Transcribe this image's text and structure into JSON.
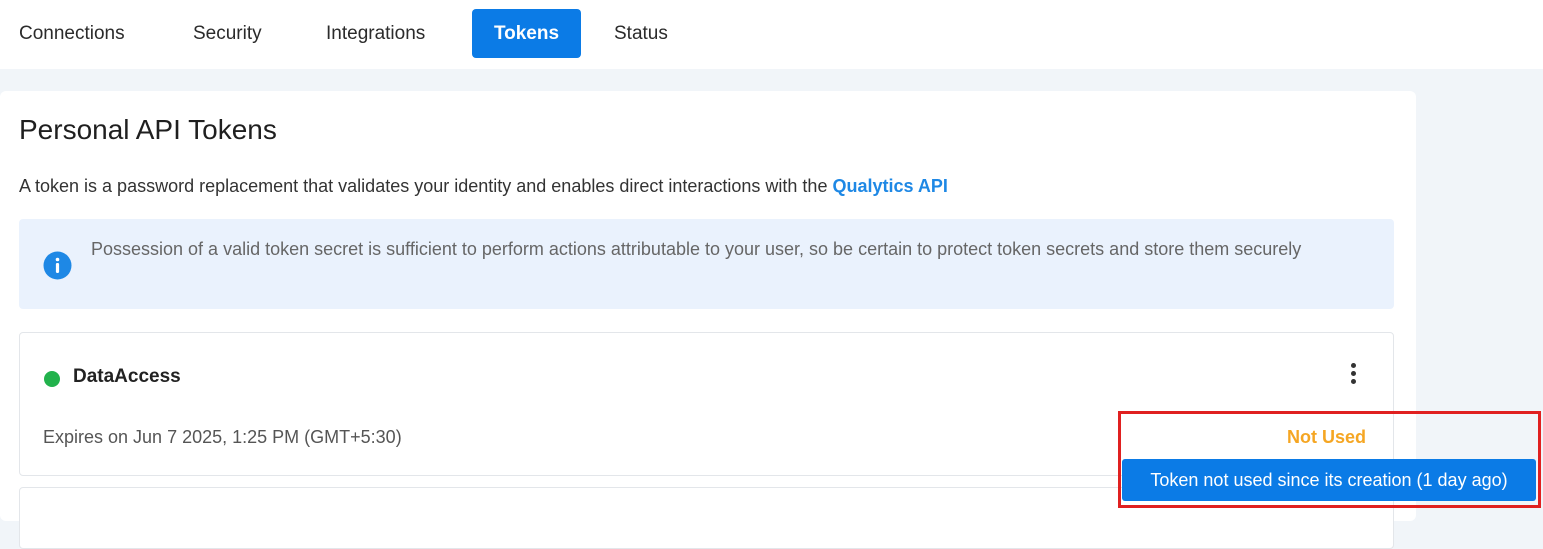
{
  "tabs": [
    {
      "label": "Connections",
      "active": false
    },
    {
      "label": "Security",
      "active": false
    },
    {
      "label": "Integrations",
      "active": false
    },
    {
      "label": "Tokens",
      "active": true
    },
    {
      "label": "Status",
      "active": false
    }
  ],
  "page": {
    "title": "Personal API Tokens",
    "description": "A token is a password replacement that validates your identity and enables direct interactions with the ",
    "description_link": "Qualytics API"
  },
  "alert": {
    "icon": "info-icon",
    "text": "Possession of a valid token secret is sufficient to perform actions attributable to your user, so be certain to protect token secrets and store them securely"
  },
  "tokens": [
    {
      "name": "DataAccess",
      "status_color": "#22b24c",
      "expires": "Expires on Jun 7 2025, 1:25 PM (GMT+5:30)",
      "usage": "Not Used",
      "usage_tooltip": "Token not used since its creation (1 day ago)"
    }
  ],
  "colors": {
    "accent": "#0b7be6",
    "highlight": "#e02020",
    "warning": "#f5a623"
  }
}
